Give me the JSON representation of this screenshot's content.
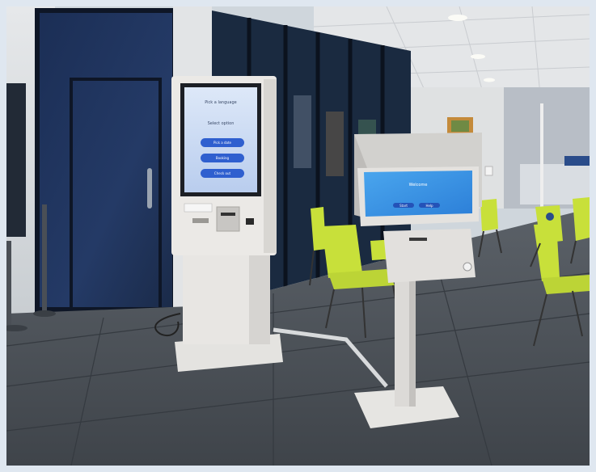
{
  "scene": {
    "description_icons": [
      "kiosk-icon",
      "chair-icon",
      "ceiling-light-icon"
    ]
  },
  "kiosk_left": {
    "screen": {
      "title": "Pick a language",
      "subtitle": "Select option",
      "buttons": [
        "Pick a date",
        "Booking",
        "Check out"
      ]
    }
  },
  "kiosk_right": {
    "screen": {
      "title": "Welcome",
      "buttons": [
        "Start",
        "Help"
      ]
    }
  },
  "colors": {
    "accent_blue": "#2f5fcf",
    "chair_green": "#c8e03a",
    "floor_dark": "#4a5058",
    "kiosk_body": "#e8e6e3"
  }
}
